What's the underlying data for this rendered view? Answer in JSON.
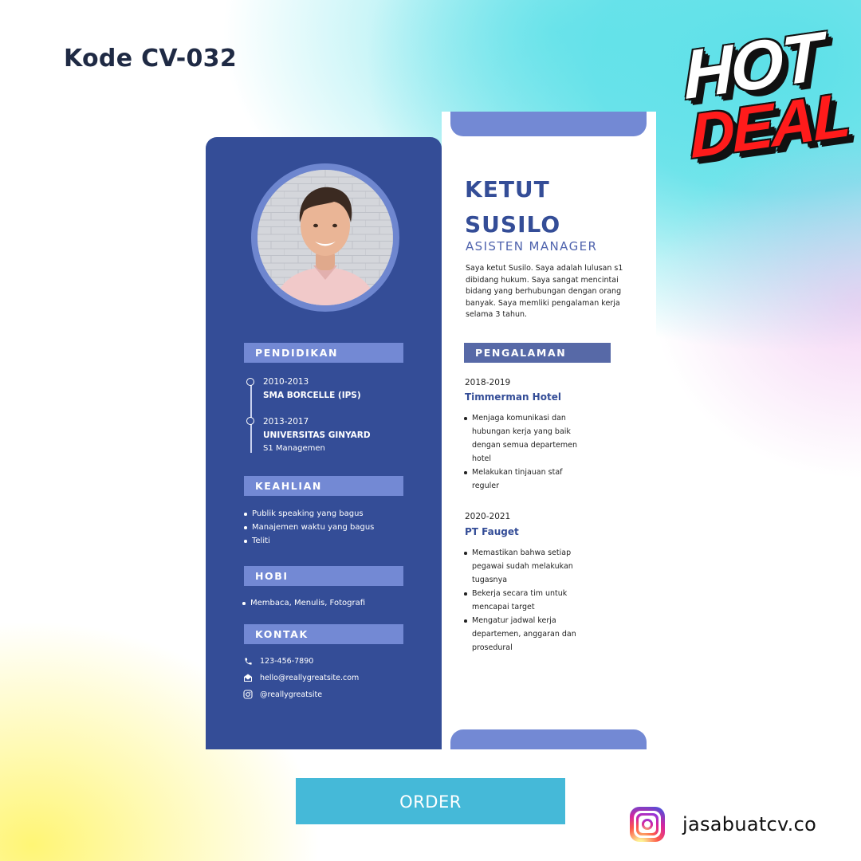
{
  "kode": "Kode CV-032",
  "badge": {
    "hot": "HOT",
    "deal": "DEAL"
  },
  "cv": {
    "name_line1": "KETUT",
    "name_line2": "SUSILO",
    "role": "ASISTEN MANAGER",
    "profile": "Saya ketut Susilo. Saya adalah lulusan s1 dibidang hukum. Saya sangat mencintai bidang yang berhubungan dengan orang banyak. Saya memliki pengalaman kerja selama 3 tahun.",
    "sections": {
      "pendidikan": "PENDIDIKAN",
      "keahlian": "KEAHLIAN",
      "hobi": "HOBI",
      "kontak": "KONTAK",
      "pengalaman": "PENGALAMAN"
    },
    "education": [
      {
        "years": "2010-2013",
        "school": "SMA BORCELLE (IPS)",
        "detail": ""
      },
      {
        "years": "2013-2017",
        "school": "UNIVERSITAS GINYARD",
        "detail": "S1 Managemen"
      }
    ],
    "skills": [
      "Publik speaking yang bagus",
      "Manajemen waktu yang bagus",
      "Teliti"
    ],
    "hobbies": [
      "Membaca, Menulis, Fotografi"
    ],
    "contact": {
      "phone": "123-456-7890",
      "email": "hello@reallygreatsite.com",
      "instagram": "@reallygreatsite"
    },
    "experience": [
      {
        "years": "2018-2019",
        "company": "Timmerman Hotel",
        "items": [
          "Menjaga komunikasi dan hubungan kerja yang baik dengan semua departemen hotel",
          "Melakukan tinjauan staf reguler"
        ]
      },
      {
        "years": "2020-2021",
        "company": "PT Fauget",
        "items": [
          "Memastikan bahwa setiap pegawai sudah melakukan tugasnya",
          "Bekerja secara tim untuk mencapai target",
          "Mengatur jadwal kerja departemen, anggaran dan prosedural"
        ]
      }
    ]
  },
  "order_label": "ORDER",
  "brand_handle": "jasabuatcv.co",
  "colors": {
    "primary": "#344d97",
    "accent": "#7389d4",
    "button": "#45b9d8",
    "hot_red": "#ff1b1b"
  },
  "icons": [
    "phone-icon",
    "mail-icon",
    "instagram-icon",
    "instagram-logo-icon"
  ]
}
